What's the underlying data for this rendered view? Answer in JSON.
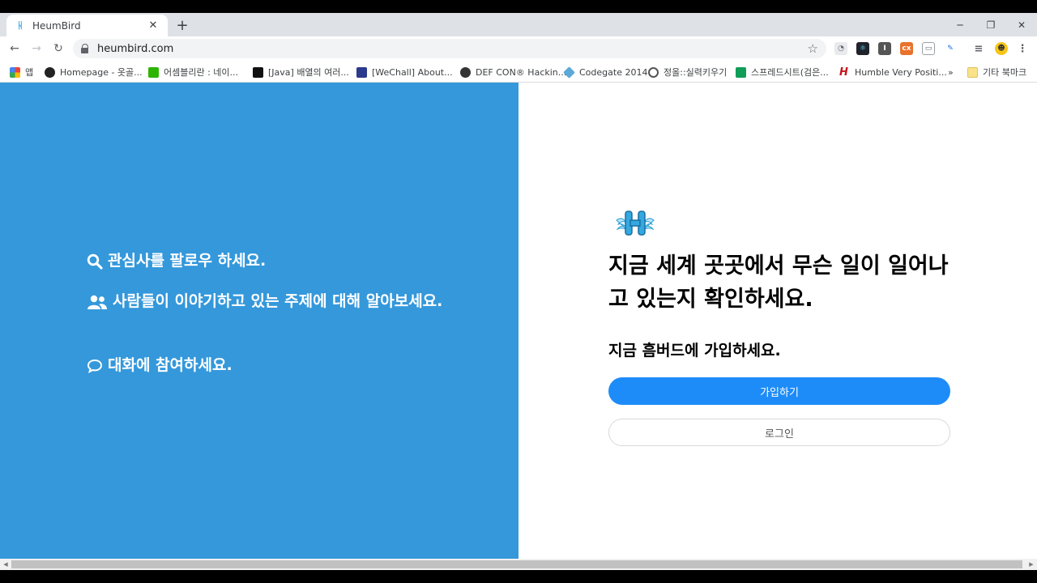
{
  "browser": {
    "tab_title": "HeumBird",
    "url": "heumbird.com",
    "bookmarks": [
      {
        "label": "앱"
      },
      {
        "label": "Homepage - 옷골..."
      },
      {
        "label": "어셈블리란 : 네이..."
      },
      {
        "label": "[Java] 배열의 여러..."
      },
      {
        "label": "[WeChall] About..."
      },
      {
        "label": "DEF CON® Hackin..."
      },
      {
        "label": "Codegate 2014"
      },
      {
        "label": "정올::실력키우기"
      },
      {
        "label": "스프레드시트(검은..."
      },
      {
        "label": "Humble Very Positi..."
      },
      {
        "label": "»"
      },
      {
        "label": "기타 북마크"
      }
    ]
  },
  "left_panel": {
    "features": [
      {
        "icon": "search-icon",
        "text": "관심사를 팔로우 하세요."
      },
      {
        "icon": "users-icon",
        "text": "사람들이 이야기하고 있는 주제에 대해 알아보세요."
      },
      {
        "icon": "comment-icon",
        "text": "대화에 참여하세요."
      }
    ],
    "color": "#3498db"
  },
  "right_panel": {
    "headline": "지금 세계 곳곳에서 무슨 일이 일어나고 있는지 확인하세요.",
    "subheading": "지금 흠버드에 가입하세요.",
    "signup_label": "가입하기",
    "login_label": "로그인",
    "accent": "#1d8cf8"
  }
}
